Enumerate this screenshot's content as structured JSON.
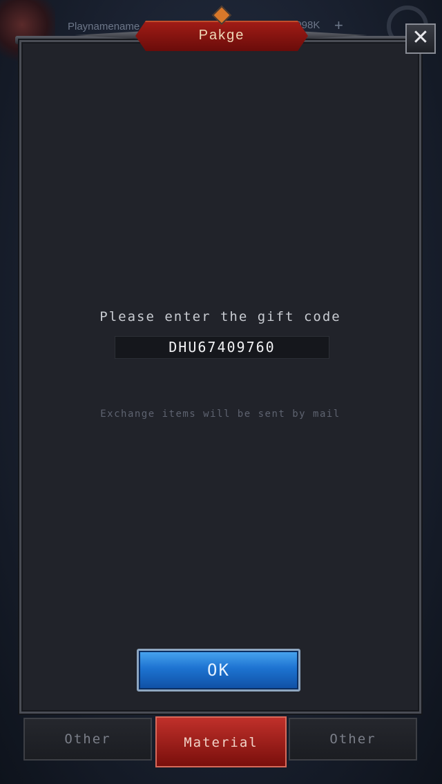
{
  "hud": {
    "player_name": "Playnamename",
    "currency": "9098K",
    "plus_symbol": "+"
  },
  "dialog": {
    "title": "Pakge",
    "close_symbol": "✕",
    "prompt": "Please enter the gift code",
    "gift_code": "DHU67409760",
    "note": "Exchange items will be sent by mail",
    "ok_label": "OK"
  },
  "tabs": [
    {
      "label": "Other",
      "active": false
    },
    {
      "label": "Material",
      "active": true
    },
    {
      "label": "Other",
      "active": false
    }
  ],
  "colors": {
    "panel": "#21232a",
    "banner": "#a01c16",
    "ok_button": "#1d73d1",
    "active_tab": "#c0302a"
  }
}
